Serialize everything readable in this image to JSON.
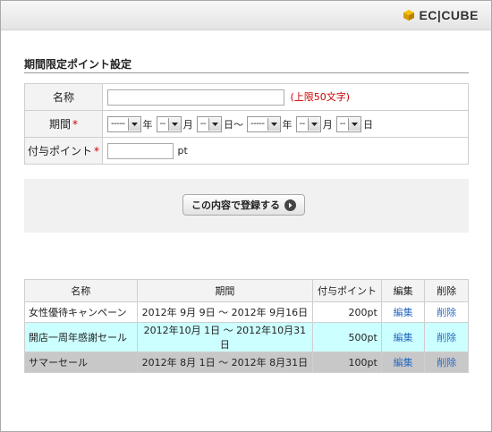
{
  "header": {
    "logo_text": "EC|CUBE",
    "logo_icon": "cube-icon"
  },
  "section": {
    "title": "期間限定ポイント設定"
  },
  "form": {
    "name_label": "名称",
    "name_value": "",
    "name_note": "(上限50文字)",
    "period_label": "期間",
    "required_mark": "*",
    "period": {
      "start_year": "-----",
      "year_unit": "年",
      "start_month": "--",
      "month_unit": "月",
      "start_day": "--",
      "day_unit_tilde": "日〜",
      "end_year": "-----",
      "end_year_unit": "年",
      "end_month": "--",
      "end_month_unit": "月",
      "end_day": "--",
      "end_day_unit": "日"
    },
    "points_label": "付与ポイント",
    "points_value": "",
    "points_unit": "pt"
  },
  "register_button": {
    "label": "この内容で登録する",
    "icon": "arrow-right-circle-icon"
  },
  "list": {
    "headers": [
      "名称",
      "期間",
      "付与ポイント",
      "編集",
      "削除"
    ],
    "rows": [
      {
        "name": "女性優待キャンペーン",
        "period": "2012年 9月 9日 〜 2012年 9月16日",
        "points": "200pt",
        "edit": "編集",
        "delete": "削除"
      },
      {
        "name": "開店一周年感謝セール",
        "period": "2012年10月 1日 〜 2012年10月31日",
        "points": "500pt",
        "edit": "編集",
        "delete": "削除"
      },
      {
        "name": "サマーセール",
        "period": "2012年 8月 1日 〜 2012年 8月31日",
        "points": "100pt",
        "edit": "編集",
        "delete": "削除"
      }
    ]
  },
  "colors": {
    "required": "#cc0000",
    "link": "#2b6bc0",
    "selected_row": "#ccffff",
    "gray_row": "#c8c8c8"
  }
}
